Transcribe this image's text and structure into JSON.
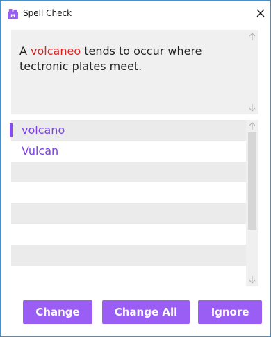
{
  "window": {
    "title": "Spell Check",
    "app_icon": "app-icon",
    "close_glyph": "✕"
  },
  "sentence": {
    "prefix": "A ",
    "misspelled_word": "volcaneo",
    "suffix": " tends to occur where tectronic plates meet."
  },
  "suggestions": {
    "items": [
      {
        "label": "volcano",
        "selected": true
      },
      {
        "label": "Vulcan",
        "selected": false
      }
    ],
    "empty_rows": 6
  },
  "buttons": {
    "change": "Change",
    "change_all": "Change All",
    "ignore": "Ignore"
  },
  "colors": {
    "accent": "#9a5ef5",
    "suggestion_text": "#7b3fe4",
    "misspelled": "#e02020",
    "border": "#4a90c8"
  }
}
